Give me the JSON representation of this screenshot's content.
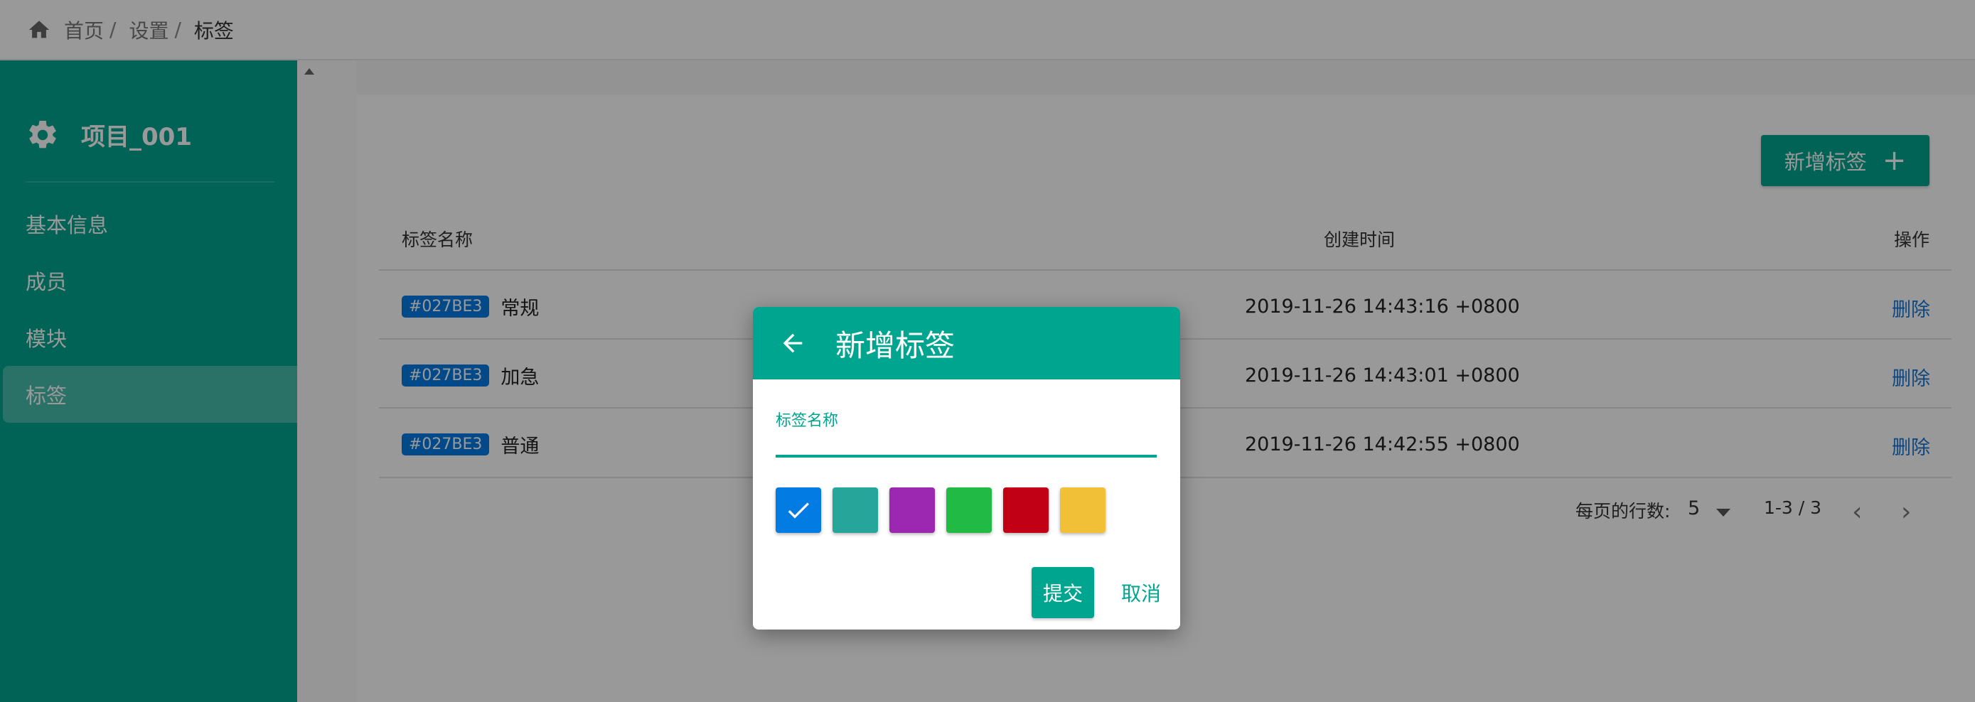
{
  "breadcrumb": {
    "home_icon": "home-icon",
    "items": [
      "首页",
      "设置",
      "标签"
    ],
    "separator": "/"
  },
  "sidebar": {
    "project_icon": "gear-icon",
    "project_name": "项目_001",
    "items": [
      {
        "label": "基本信息",
        "active": false
      },
      {
        "label": "成员",
        "active": false
      },
      {
        "label": "模块",
        "active": false
      },
      {
        "label": "标签",
        "active": true
      }
    ]
  },
  "toolbar": {
    "add_label": "新增标签",
    "add_icon": "plus-icon"
  },
  "table": {
    "headers": [
      "标签名称",
      "创建时间",
      "操作"
    ],
    "rows": [
      {
        "color_code": "#027BE3",
        "name": "常规",
        "created": "2019-11-26 14:43:16 +0800",
        "action": "删除"
      },
      {
        "color_code": "#027BE3",
        "name": "加急",
        "created": "2019-11-26 14:43:01 +0800",
        "action": "删除"
      },
      {
        "color_code": "#027BE3",
        "name": "普通",
        "created": "2019-11-26 14:42:55 +0800",
        "action": "删除"
      }
    ]
  },
  "pagination": {
    "rows_per_page_label": "每页的行数:",
    "rows_per_page": "5",
    "range": "1-3 / 3"
  },
  "dialog": {
    "title": "新增标签",
    "back_icon": "arrow-left-icon",
    "field_label": "标签名称",
    "field_value": "",
    "colors": [
      "#027be3",
      "#26a69a",
      "#9c27b0",
      "#21ba45",
      "#c10015",
      "#f2c037"
    ],
    "selected_color_index": 0,
    "submit_label": "提交",
    "cancel_label": "取消"
  },
  "colors": {
    "primary": "#00a58f",
    "chip": "#027be3",
    "link": "#1976d2"
  }
}
